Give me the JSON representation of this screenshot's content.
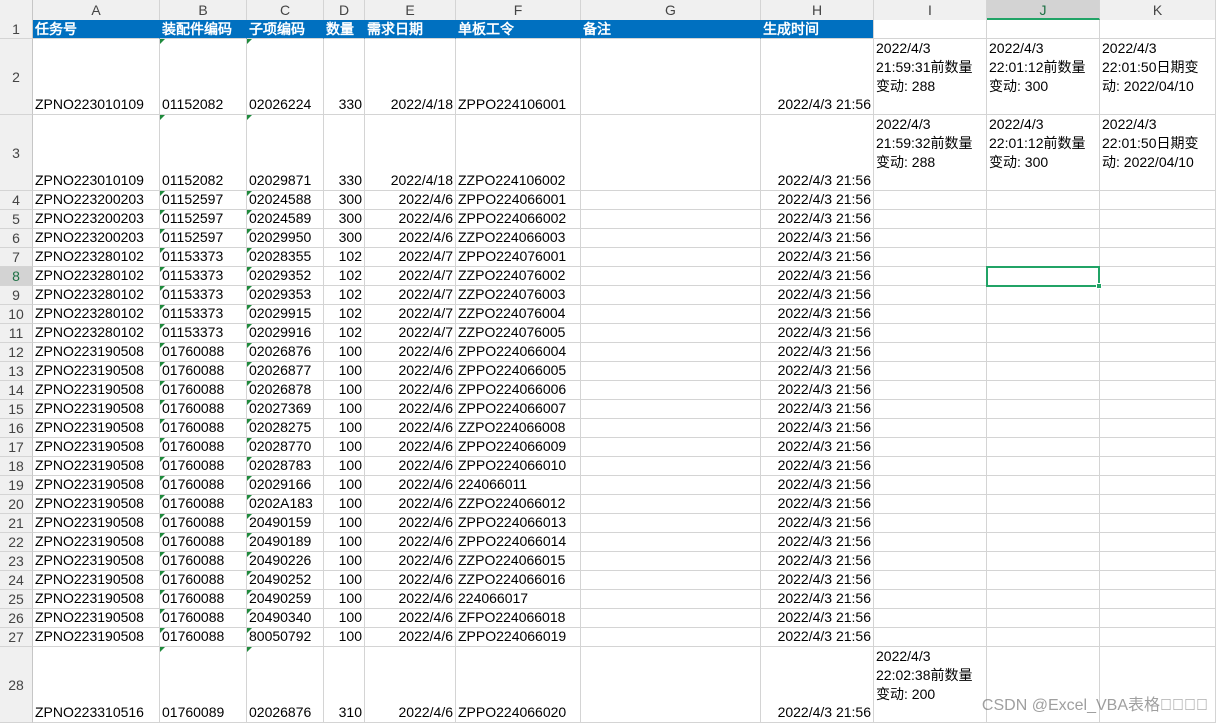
{
  "columns": [
    "A",
    "B",
    "C",
    "D",
    "E",
    "F",
    "G",
    "H",
    "I",
    "J",
    "K"
  ],
  "active_column": "J",
  "active_row": 8,
  "header_row": [
    "任务号",
    "装配件编码",
    "子项编码",
    "数量",
    "需求日期",
    "单板工令",
    "备注",
    "生成时间",
    "",
    "",
    ""
  ],
  "rows": [
    {
      "n": 2,
      "a": "ZPNO223010109",
      "b": "01152082",
      "c": "02026224",
      "d": "330",
      "e": "2022/4/18",
      "f": "ZPPO224106001",
      "g": "",
      "h": "2022/4/3 21:56",
      "i": "2022/4/3 21:59:31前数量变动: 288",
      "j": "2022/4/3 22:01:12前数量变动: 300",
      "k": "2022/4/3 22:01:50日期变动: 2022/04/10"
    },
    {
      "n": 3,
      "a": "ZPNO223010109",
      "b": "01152082",
      "c": "02029871",
      "d": "330",
      "e": "2022/4/18",
      "f": "ZZPO224106002",
      "g": "",
      "h": "2022/4/3 21:56",
      "i": "2022/4/3 21:59:32前数量变动: 288",
      "j": "2022/4/3 22:01:12前数量变动: 300",
      "k": "2022/4/3 22:01:50日期变动: 2022/04/10"
    },
    {
      "n": 4,
      "a": "ZPNO223200203",
      "b": "01152597",
      "c": "02024588",
      "d": "300",
      "e": "2022/4/6",
      "f": "ZPPO224066001",
      "g": "",
      "h": "2022/4/3 21:56",
      "i": "",
      "j": "",
      "k": ""
    },
    {
      "n": 5,
      "a": "ZPNO223200203",
      "b": "01152597",
      "c": "02024589",
      "d": "300",
      "e": "2022/4/6",
      "f": "ZPPO224066002",
      "g": "",
      "h": "2022/4/3 21:56",
      "i": "",
      "j": "",
      "k": ""
    },
    {
      "n": 6,
      "a": "ZPNO223200203",
      "b": "01152597",
      "c": "02029950",
      "d": "300",
      "e": "2022/4/6",
      "f": "ZZPO224066003",
      "g": "",
      "h": "2022/4/3 21:56",
      "i": "",
      "j": "",
      "k": ""
    },
    {
      "n": 7,
      "a": "ZPNO223280102",
      "b": "01153373",
      "c": "02028355",
      "d": "102",
      "e": "2022/4/7",
      "f": "ZPPO224076001",
      "g": "",
      "h": "2022/4/3 21:56",
      "i": "",
      "j": "",
      "k": ""
    },
    {
      "n": 8,
      "a": "ZPNO223280102",
      "b": "01153373",
      "c": "02029352",
      "d": "102",
      "e": "2022/4/7",
      "f": "ZZPO224076002",
      "g": "",
      "h": "2022/4/3 21:56",
      "i": "",
      "j": "",
      "k": ""
    },
    {
      "n": 9,
      "a": "ZPNO223280102",
      "b": "01153373",
      "c": "02029353",
      "d": "102",
      "e": "2022/4/7",
      "f": "ZZPO224076003",
      "g": "",
      "h": "2022/4/3 21:56",
      "i": "",
      "j": "",
      "k": ""
    },
    {
      "n": 10,
      "a": "ZPNO223280102",
      "b": "01153373",
      "c": "02029915",
      "d": "102",
      "e": "2022/4/7",
      "f": "ZZPO224076004",
      "g": "",
      "h": "2022/4/3 21:56",
      "i": "",
      "j": "",
      "k": ""
    },
    {
      "n": 11,
      "a": "ZPNO223280102",
      "b": "01153373",
      "c": "02029916",
      "d": "102",
      "e": "2022/4/7",
      "f": "ZZPO224076005",
      "g": "",
      "h": "2022/4/3 21:56",
      "i": "",
      "j": "",
      "k": ""
    },
    {
      "n": 12,
      "a": "ZPNO223190508",
      "b": "01760088",
      "c": "02026876",
      "d": "100",
      "e": "2022/4/6",
      "f": "ZPPO224066004",
      "g": "",
      "h": "2022/4/3 21:56",
      "i": "",
      "j": "",
      "k": ""
    },
    {
      "n": 13,
      "a": "ZPNO223190508",
      "b": "01760088",
      "c": "02026877",
      "d": "100",
      "e": "2022/4/6",
      "f": "ZPPO224066005",
      "g": "",
      "h": "2022/4/3 21:56",
      "i": "",
      "j": "",
      "k": ""
    },
    {
      "n": 14,
      "a": "ZPNO223190508",
      "b": "01760088",
      "c": "02026878",
      "d": "100",
      "e": "2022/4/6",
      "f": "ZPPO224066006",
      "g": "",
      "h": "2022/4/3 21:56",
      "i": "",
      "j": "",
      "k": ""
    },
    {
      "n": 15,
      "a": "ZPNO223190508",
      "b": "01760088",
      "c": "02027369",
      "d": "100",
      "e": "2022/4/6",
      "f": "ZPPO224066007",
      "g": "",
      "h": "2022/4/3 21:56",
      "i": "",
      "j": "",
      "k": ""
    },
    {
      "n": 16,
      "a": "ZPNO223190508",
      "b": "01760088",
      "c": "02028275",
      "d": "100",
      "e": "2022/4/6",
      "f": "ZZPO224066008",
      "g": "",
      "h": "2022/4/3 21:56",
      "i": "",
      "j": "",
      "k": ""
    },
    {
      "n": 17,
      "a": "ZPNO223190508",
      "b": "01760088",
      "c": "02028770",
      "d": "100",
      "e": "2022/4/6",
      "f": "ZPPO224066009",
      "g": "",
      "h": "2022/4/3 21:56",
      "i": "",
      "j": "",
      "k": ""
    },
    {
      "n": 18,
      "a": "ZPNO223190508",
      "b": "01760088",
      "c": "02028783",
      "d": "100",
      "e": "2022/4/6",
      "f": "ZPPO224066010",
      "g": "",
      "h": "2022/4/3 21:56",
      "i": "",
      "j": "",
      "k": ""
    },
    {
      "n": 19,
      "a": "ZPNO223190508",
      "b": "01760088",
      "c": "02029166",
      "d": "100",
      "e": "2022/4/6",
      "f": "224066011",
      "g": "",
      "h": "2022/4/3 21:56",
      "i": "",
      "j": "",
      "k": ""
    },
    {
      "n": 20,
      "a": "ZPNO223190508",
      "b": "01760088",
      "c": "0202A183",
      "d": "100",
      "e": "2022/4/6",
      "f": "ZZPO224066012",
      "g": "",
      "h": "2022/4/3 21:56",
      "i": "",
      "j": "",
      "k": ""
    },
    {
      "n": 21,
      "a": "ZPNO223190508",
      "b": "01760088",
      "c": "20490159",
      "d": "100",
      "e": "2022/4/6",
      "f": "ZPPO224066013",
      "g": "",
      "h": "2022/4/3 21:56",
      "i": "",
      "j": "",
      "k": ""
    },
    {
      "n": 22,
      "a": "ZPNO223190508",
      "b": "01760088",
      "c": "20490189",
      "d": "100",
      "e": "2022/4/6",
      "f": "ZPPO224066014",
      "g": "",
      "h": "2022/4/3 21:56",
      "i": "",
      "j": "",
      "k": ""
    },
    {
      "n": 23,
      "a": "ZPNO223190508",
      "b": "01760088",
      "c": "20490226",
      "d": "100",
      "e": "2022/4/6",
      "f": "ZZPO224066015",
      "g": "",
      "h": "2022/4/3 21:56",
      "i": "",
      "j": "",
      "k": ""
    },
    {
      "n": 24,
      "a": "ZPNO223190508",
      "b": "01760088",
      "c": "20490252",
      "d": "100",
      "e": "2022/4/6",
      "f": "ZZPO224066016",
      "g": "",
      "h": "2022/4/3 21:56",
      "i": "",
      "j": "",
      "k": ""
    },
    {
      "n": 25,
      "a": "ZPNO223190508",
      "b": "01760088",
      "c": "20490259",
      "d": "100",
      "e": "2022/4/6",
      "f": "224066017",
      "g": "",
      "h": "2022/4/3 21:56",
      "i": "",
      "j": "",
      "k": ""
    },
    {
      "n": 26,
      "a": "ZPNO223190508",
      "b": "01760088",
      "c": "20490340",
      "d": "100",
      "e": "2022/4/6",
      "f": "ZFPO224066018",
      "g": "",
      "h": "2022/4/3 21:56",
      "i": "",
      "j": "",
      "k": ""
    },
    {
      "n": 27,
      "a": "ZPNO223190508",
      "b": "01760088",
      "c": "80050792",
      "d": "100",
      "e": "2022/4/6",
      "f": "ZPPO224066019",
      "g": "",
      "h": "2022/4/3 21:56",
      "i": "",
      "j": "",
      "k": ""
    },
    {
      "n": 28,
      "a": "ZPNO223310516",
      "b": "01760089",
      "c": "02026876",
      "d": "310",
      "e": "2022/4/6",
      "f": "ZPPO224066020",
      "g": "",
      "h": "2022/4/3 21:56",
      "i": "2022/4/3 22:02:38前数量变动: 200",
      "j": "",
      "k": ""
    }
  ],
  "watermark": "CSDN @Excel_VBA表格\u0000\u0000\u0000\u0000",
  "colors": {
    "header_bg": "#0070c0",
    "selection": "#21a366",
    "grid": "#d4d4d4"
  }
}
